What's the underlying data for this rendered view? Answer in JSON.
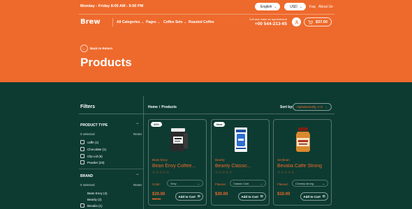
{
  "topbar": {
    "hours": "Monday - Friday 8:00 AM - 9:00 PM",
    "language": "English",
    "currency": "USD",
    "links": [
      "Faq",
      "About Us"
    ]
  },
  "nav": {
    "logo": "Brew",
    "items": [
      "All Categories",
      "Pages",
      "Coffee Sets",
      "Roasted Coffee"
    ],
    "call_text": "Call and make an appointment",
    "phone": "+00 544-213-65",
    "cart_total": "$37.00"
  },
  "hero": {
    "back_label": "Back to Return",
    "title": "Products"
  },
  "filters": {
    "title": "Filters",
    "product_type": {
      "title": "PRODUCT TYPE",
      "selected": "0 selected",
      "reset": "Reset",
      "options": [
        "caffe (1)",
        "Chocolate (1)",
        "Clip Lid (6)",
        "Powder (23)"
      ]
    },
    "brand": {
      "title": "BRAND",
      "selected": "0 selected",
      "reset": "Reset",
      "options": [
        "Bean Envy (4)",
        "Beanly (2)",
        "Bevalia (1)"
      ]
    }
  },
  "products_header": {
    "breadcrumb": [
      "Home",
      "Products"
    ],
    "sort_label": "Sort by:",
    "sort_value": "Alphabetically, A-Z"
  },
  "products": [
    {
      "badge": "33%",
      "brand": "Bean Envy",
      "name": "Bean Envy Coffee...",
      "stars": "☆☆☆☆☆",
      "option_label": "Color:",
      "option_value": "Grey",
      "price": "$20.00",
      "old_price": "$30.00",
      "add_label": "Add to Cart"
    },
    {
      "badge": "New",
      "brand": "Beanly",
      "name": "Beanly Classic...",
      "stars": "☆☆☆☆☆",
      "option_label": "Flavour:",
      "option_value": "Classic Cold",
      "price": "$30.00",
      "old_price": "",
      "add_label": "Add to Cart"
    },
    {
      "badge": "",
      "brand": "Sevbean",
      "name": "Bevalia Caffe Strong",
      "stars": "☆☆☆☆☆",
      "option_label": "Flavour:",
      "option_value": "Creamy strong",
      "price": "$10.00",
      "old_price": "",
      "add_label": "Add to Cart"
    }
  ]
}
